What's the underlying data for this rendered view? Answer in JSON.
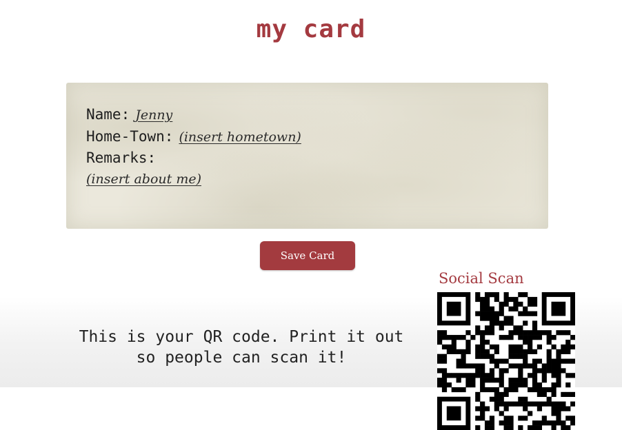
{
  "page": {
    "title": "my card"
  },
  "card": {
    "name_label": "Name:",
    "name_value": "Jenny",
    "hometown_label": "Home-Town:",
    "hometown_value": "(insert hometown)",
    "remarks_label": "Remarks:",
    "remarks_value": "(insert about me)"
  },
  "actions": {
    "save_label": "Save Card"
  },
  "qr": {
    "title": "Social Scan",
    "message_line1": "This is your QR code. Print it out",
    "message_line2": "so people can scan it!"
  },
  "colors": {
    "accent": "#a43a40",
    "button": "#a33b3f",
    "card_background": "#ebe8dc"
  }
}
